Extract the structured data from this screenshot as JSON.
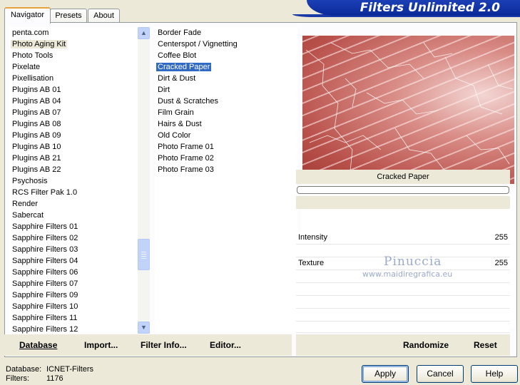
{
  "app": {
    "title": "Filters Unlimited 2.0"
  },
  "tabs": [
    {
      "label": "Navigator",
      "active": true
    },
    {
      "label": "Presets",
      "active": false
    },
    {
      "label": "About",
      "active": false
    }
  ],
  "categories": {
    "selected": "Photo Aging Kit",
    "items": [
      "penta.com",
      "Photo Aging Kit",
      "Photo Tools",
      "Pixelate",
      "Pixellisation",
      "Plugins AB 01",
      "Plugins AB 04",
      "Plugins AB 07",
      "Plugins AB 08",
      "Plugins AB 09",
      "Plugins AB 10",
      "Plugins AB 21",
      "Plugins AB 22",
      "Psychosis",
      "RCS Filter Pak 1.0",
      "Render",
      "Sabercat",
      "Sapphire Filters 01",
      "Sapphire Filters 02",
      "Sapphire Filters 03",
      "Sapphire Filters 04",
      "Sapphire Filters 06",
      "Sapphire Filters 07",
      "Sapphire Filters 09",
      "Sapphire Filters 10",
      "Sapphire Filters 11",
      "Sapphire Filters 12"
    ]
  },
  "filters": {
    "selected": "Cracked Paper",
    "items": [
      "Border Fade",
      "Centerspot / Vignetting",
      "Coffee Blot",
      "Cracked Paper",
      "Dirt & Dust",
      "Dirt",
      "Dust & Scratches",
      "Film Grain",
      "Hairs & Dust",
      "Old Color",
      "Photo Frame 01",
      "Photo Frame 02",
      "Photo Frame 03"
    ]
  },
  "preview": {
    "filter_name": "Cracked Paper"
  },
  "params": [
    {
      "label": "Intensity",
      "value": "255"
    },
    {
      "label": "Texture",
      "value": "255"
    }
  ],
  "watermark": {
    "title": "Pinuccia",
    "url": "www.maidiregrafica.eu"
  },
  "toolbar": {
    "database": "Database",
    "import": "Import...",
    "filter_info": "Filter Info...",
    "editor": "Editor...",
    "randomize": "Randomize",
    "reset": "Reset"
  },
  "status": {
    "database_label": "Database:",
    "database_value": "ICNET-Filters",
    "filters_label": "Filters:",
    "filters_value": "1176"
  },
  "buttons": {
    "apply": "Apply",
    "cancel": "Cancel",
    "help": "Help"
  },
  "colors": {
    "banner": "#0a2a9a",
    "selection": "#316ac5",
    "window": "#ece9d8"
  }
}
